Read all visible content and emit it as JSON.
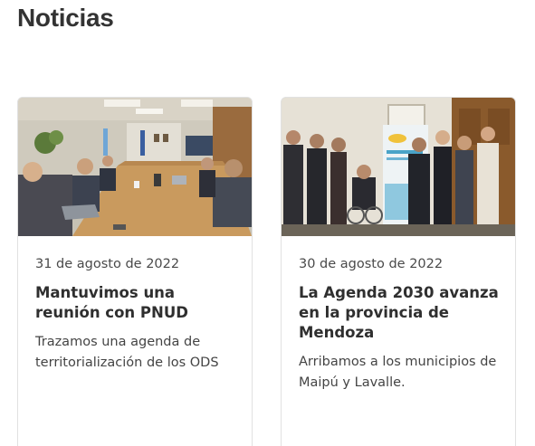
{
  "section": {
    "title": "Noticias"
  },
  "cards": [
    {
      "image_alt": "Reunión en sala de conferencias con mesa de madera",
      "date": "31 de agosto de 2022",
      "headline": "Mantuvimos una reunión con PNUD",
      "summary": "Trazamos una agenda de territorialización de los ODS"
    },
    {
      "image_alt": "Grupo de personas posando junto a un banner",
      "date": "30 de agosto de 2022",
      "headline": "La Agenda 2030 avanza en la provincia de Mendoza",
      "summary": "Arribamos a los municipios de Maipú y Lavalle."
    }
  ]
}
